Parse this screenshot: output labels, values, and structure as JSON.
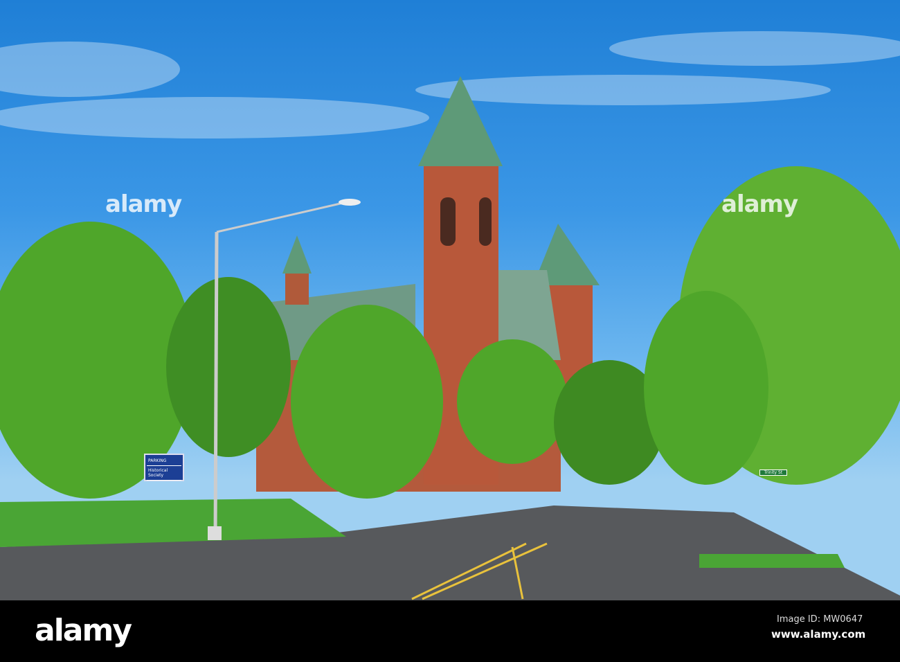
{
  "photo": {
    "watermark": "alamy",
    "sign": {
      "line1": "PARKING",
      "line2": "Historical Society"
    },
    "street_sign": "Trinity St"
  },
  "footer": {
    "logo": "alamy",
    "image_id": "Image ID: MW0647",
    "url": "www.alamy.com"
  }
}
